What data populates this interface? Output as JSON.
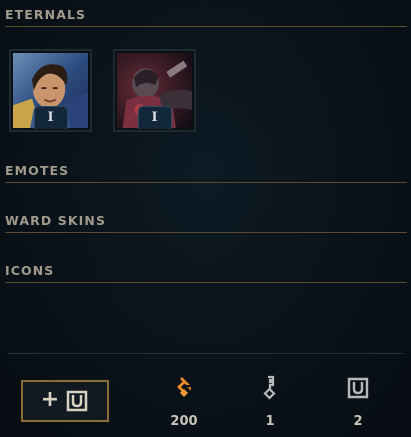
{
  "sections": {
    "eternals": "ETERNALS",
    "emotes": "EMOTES",
    "ward_skins": "WARD SKINS",
    "icons": "ICONS"
  },
  "eternal_tiles": [
    {
      "name": "garen",
      "badge": "I"
    },
    {
      "name": "dark-champion",
      "badge": "I"
    }
  ],
  "footer": {
    "add_button_icon": "plus-token-icon",
    "currencies": [
      {
        "icon": "orange-essence-icon",
        "amount": "200",
        "color": "#e8872a"
      },
      {
        "icon": "hextech-key-icon",
        "amount": "1",
        "color": "#b9b9b9"
      },
      {
        "icon": "eternals-token-icon",
        "amount": "2",
        "color": "#b9b9b9"
      }
    ]
  }
}
